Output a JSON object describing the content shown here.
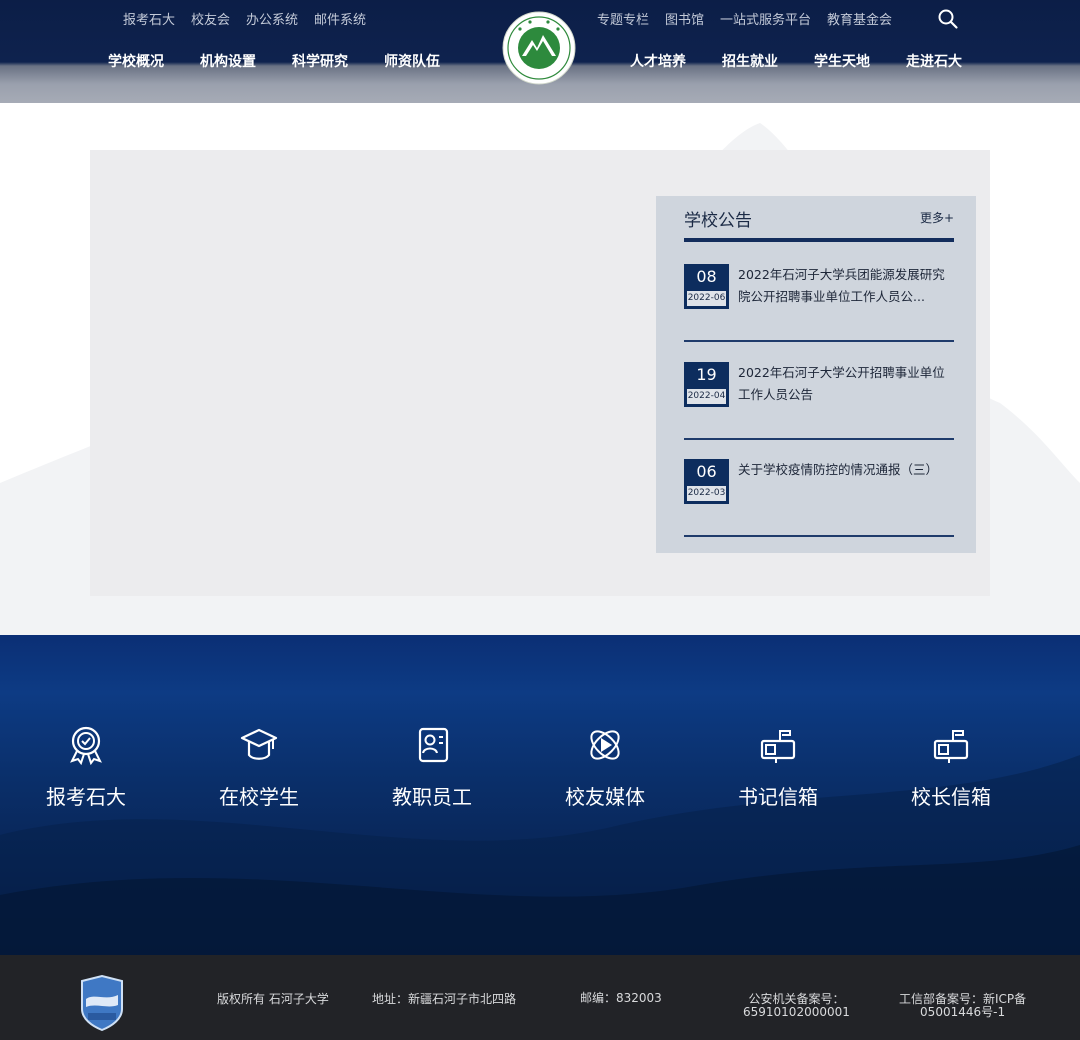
{
  "header": {
    "top_links_left": [
      "报考石大",
      "校友会",
      "办公系统",
      "邮件系统"
    ],
    "top_links_right": [
      "专题专栏",
      "图书馆",
      "一站式服务平台",
      "教育基金会"
    ],
    "nav_left": [
      "学校概况",
      "机构设置",
      "科学研究",
      "师资队伍"
    ],
    "nav_right": [
      "人才培养",
      "招生就业",
      "学生天地",
      "走进石大"
    ],
    "search_icon": "search-icon",
    "logo_icon": "university-logo"
  },
  "notices": {
    "title": "学校公告",
    "more": "更多+",
    "items": [
      {
        "day": "08",
        "ym": "2022-06",
        "text": "2022年石河子大学兵团能源发展研究院公开招聘事业单位工作人员公..."
      },
      {
        "day": "19",
        "ym": "2022-04",
        "text": "2022年石河子大学公开招聘事业单位工作人员公告"
      },
      {
        "day": "06",
        "ym": "2022-03",
        "text": "关于学校疫情防控的情况通报（三）"
      }
    ]
  },
  "services": [
    {
      "label": "报考石大",
      "icon": "award-ribbon-icon"
    },
    {
      "label": "在校学生",
      "icon": "graduation-cap-icon"
    },
    {
      "label": "教职员工",
      "icon": "staff-id-icon"
    },
    {
      "label": "校友媒体",
      "icon": "play-orbit-icon"
    },
    {
      "label": "书记信箱",
      "icon": "mailbox-icon"
    },
    {
      "label": "校长信箱",
      "icon": "mailbox-icon"
    }
  ],
  "footer": {
    "copyright": "版权所有 石河子大学",
    "address": "地址：新疆石河子市北四路",
    "postcode": "邮编：832003",
    "police_line1": "公安机关备案号：",
    "police_line2": "65910102000001",
    "icp_line1": "工信部备案号：新ICP备",
    "icp_line2": "05001446号-1",
    "badge_icon": "gov-badge-icon"
  },
  "colors": {
    "header_navy": "#0e224e",
    "notice_bg": "#cfd5dd",
    "date_box": "#0d2d5e",
    "services_blue": "#0b2f75",
    "footer_bg": "#222327"
  }
}
